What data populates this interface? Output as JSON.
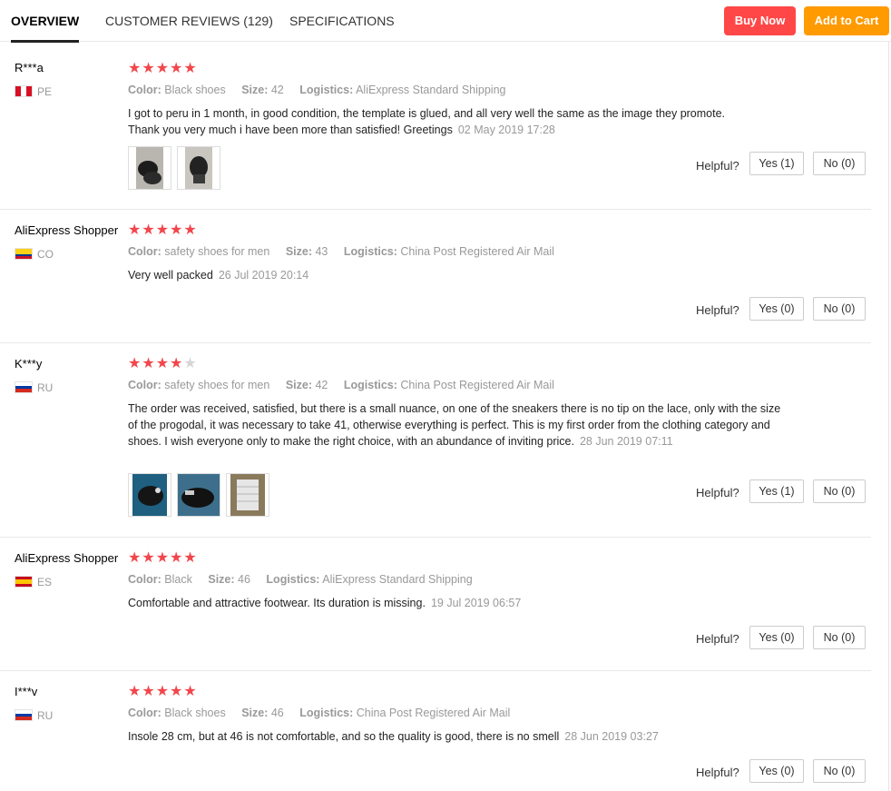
{
  "tabs": [
    {
      "label": "OVERVIEW"
    },
    {
      "label": "CUSTOMER REVIEWS (129)"
    },
    {
      "label": "SPECIFICATIONS"
    }
  ],
  "buttons": {
    "buy_now": "Buy Now",
    "add_to_cart": "Add to Cart"
  },
  "colors": {
    "buy_now": "#ff4747",
    "add_to_cart": "#ff9a00",
    "star": "#f2464b"
  },
  "labels": {
    "color": "Color:",
    "size": "Size:",
    "logistics": "Logistics:",
    "helpful": "Helpful?"
  },
  "reviews": [
    {
      "user": "R***a",
      "country": "PE",
      "rating": 5,
      "color": "Black shoes",
      "size": "42",
      "logistics": "AliExpress Standard Shipping",
      "text": "I got to peru in 1 month, in good condition, the template is glued, and all very well the same as the image they promote. Thank you very much i have been more than satisfied! Greetings",
      "date": "02 May 2019 17:28",
      "yes": "Yes (1)",
      "no": "No (0)",
      "photos": [
        "black-shoes-photo",
        "black-shoes-photo"
      ]
    },
    {
      "user": "AliExpress Shopper",
      "country": "CO",
      "rating": 5,
      "color": "safety shoes for men",
      "size": "43",
      "logistics": "China Post Registered Air Mail",
      "text": "Very well packed",
      "date": "26 Jul 2019 20:14",
      "yes": "Yes (0)",
      "no": "No (0)",
      "photos": []
    },
    {
      "user": "K***y",
      "country": "RU",
      "rating": 4,
      "color": "safety shoes for men",
      "size": "42",
      "logistics": "China Post Registered Air Mail",
      "text": "The order was received, satisfied, but there is a small nuance, on one of the sneakers there is no tip on the lace, only with the size of the progodal, it was necessary to take 41, otherwise everything is perfect. This is my first order from the clothing category and shoes. I wish everyone only to make the right choice, with an abundance of inviting price.",
      "date": "28 Jun 2019 07:11",
      "yes": "Yes (1)",
      "no": "No (0)",
      "photos": [
        "shoe-photo",
        "shoe-photo",
        "package-photo"
      ]
    },
    {
      "user": "AliExpress Shopper",
      "country": "ES",
      "rating": 5,
      "color": "Black",
      "size": "46",
      "logistics": "AliExpress Standard Shipping",
      "text": "Comfortable and attractive footwear. Its duration is missing.",
      "date": "19 Jul 2019 06:57",
      "yes": "Yes (0)",
      "no": "No (0)",
      "photos": []
    },
    {
      "user": "I***v",
      "country": "RU",
      "rating": 5,
      "color": "Black shoes",
      "size": "46",
      "logistics": "China Post Registered Air Mail",
      "text": "Insole 28 cm, but at 46 is not comfortable, and so the quality is good, there is no smell",
      "date": "28 Jun 2019 03:27",
      "yes": "Yes (0)",
      "no": "No (0)",
      "photos": []
    }
  ]
}
